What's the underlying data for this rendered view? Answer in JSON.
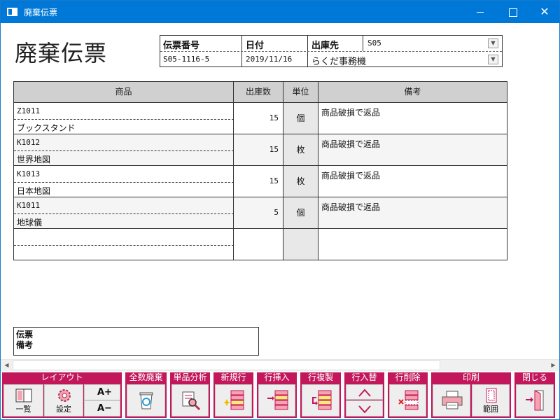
{
  "window": {
    "title": "廃棄伝票"
  },
  "page": {
    "title": "廃棄伝票"
  },
  "header": {
    "slip_no_label": "伝票番号",
    "slip_no": "S05-1116-5",
    "date_label": "日付",
    "date": "2019/11/16",
    "dest_label": "出庫先",
    "dest_code": "S05",
    "dest_name": "らくだ事務機"
  },
  "grid": {
    "columns": [
      "商品",
      "出庫数",
      "単位",
      "備考"
    ],
    "rows": [
      {
        "code": "Z1011",
        "name": "ブックスタンド",
        "qty": "15",
        "unit": "個",
        "note": "商品破損で返品"
      },
      {
        "code": "K1012",
        "name": "世界地図",
        "qty": "15",
        "unit": "枚",
        "note": "商品破損で返品"
      },
      {
        "code": "K1013",
        "name": "日本地図",
        "qty": "15",
        "unit": "枚",
        "note": "商品破損で返品"
      },
      {
        "code": "K1011",
        "name": "地球儀",
        "qty": "5",
        "unit": "個",
        "note": "商品破損で返品"
      },
      {
        "code": "",
        "name": "",
        "qty": "",
        "unit": "",
        "note": ""
      }
    ]
  },
  "memo": {
    "label_line1": "伝票",
    "label_line2": "備考"
  },
  "toolbar": {
    "layout_label": "レイアウト",
    "list_caption": "一覧",
    "settings_caption": "設定",
    "font_up": "A+",
    "font_down": "A−",
    "discard_all_label": "全数廃棄",
    "item_analysis_label": "単品分析",
    "new_row_label": "新規行",
    "insert_row_label": "行挿入",
    "copy_row_label": "行複製",
    "swap_row_label": "行入替",
    "delete_row_label": "行削除",
    "print_label": "印刷",
    "range_caption": "範囲",
    "close_label": "閉じる"
  },
  "colors": {
    "titlebar": "#0078d7",
    "toolbar_group": "#c2185b",
    "grid_header": "#d0d0d0"
  }
}
